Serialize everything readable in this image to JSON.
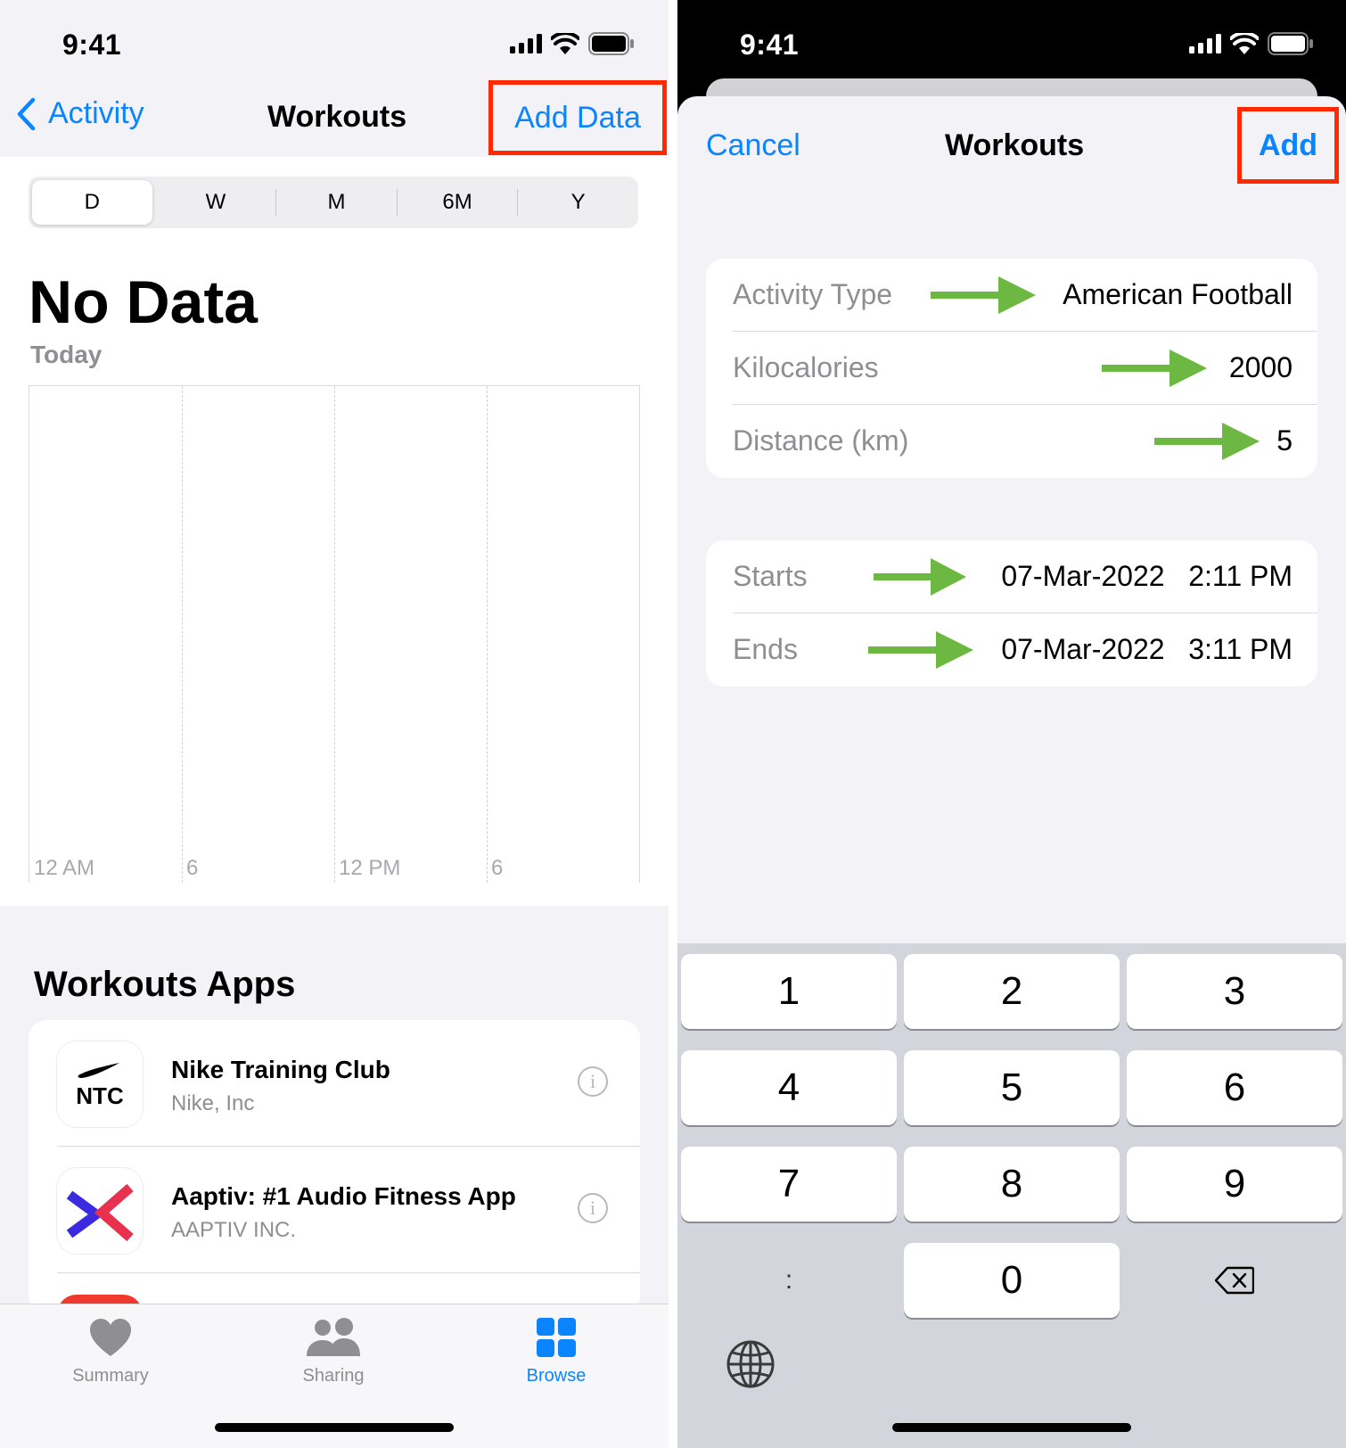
{
  "left": {
    "status": {
      "time": "9:41"
    },
    "nav": {
      "back_label": "Activity",
      "title": "Workouts",
      "action_label": "Add Data"
    },
    "segments": [
      "D",
      "W",
      "M",
      "6M",
      "Y"
    ],
    "selected_segment": "D",
    "summary": {
      "value": "No Data",
      "period": "Today"
    },
    "chart_ticks": [
      "12 AM",
      "6",
      "12 PM",
      "6"
    ],
    "apps_section": {
      "title": "Workouts Apps",
      "apps": [
        {
          "name": "Nike Training Club",
          "developer": "Nike, Inc",
          "icon": "ntc-icon",
          "icon_text": "NTC"
        },
        {
          "name": "Aaptiv: #1 Audio Fitness App",
          "developer": "AAPTIV INC.",
          "icon": "aaptiv-icon"
        }
      ]
    },
    "tabs": [
      {
        "label": "Summary",
        "icon": "heart-icon",
        "active": false
      },
      {
        "label": "Sharing",
        "icon": "people-icon",
        "active": false
      },
      {
        "label": "Browse",
        "icon": "grid-icon",
        "active": true
      }
    ]
  },
  "right": {
    "status": {
      "time": "9:41"
    },
    "nav": {
      "cancel_label": "Cancel",
      "title": "Workouts",
      "add_label": "Add"
    },
    "details": [
      {
        "label": "Activity Type",
        "value": "American Football"
      },
      {
        "label": "Kilocalories",
        "value": "2000"
      },
      {
        "label": "Distance (km)",
        "value": "5"
      }
    ],
    "times": [
      {
        "label": "Starts",
        "date": "07-Mar-2022",
        "time": "2:11 PM"
      },
      {
        "label": "Ends",
        "date": "07-Mar-2022",
        "time": "3:11 PM"
      }
    ],
    "keypad": {
      "keys": [
        "1",
        "2",
        "3",
        "4",
        "5",
        "6",
        "7",
        "8",
        "9",
        "0"
      ],
      "separator_key": ":"
    }
  },
  "colors": {
    "accent": "#0a84ff",
    "highlight_box": "#ff2a00",
    "arrow": "#6cb842"
  }
}
